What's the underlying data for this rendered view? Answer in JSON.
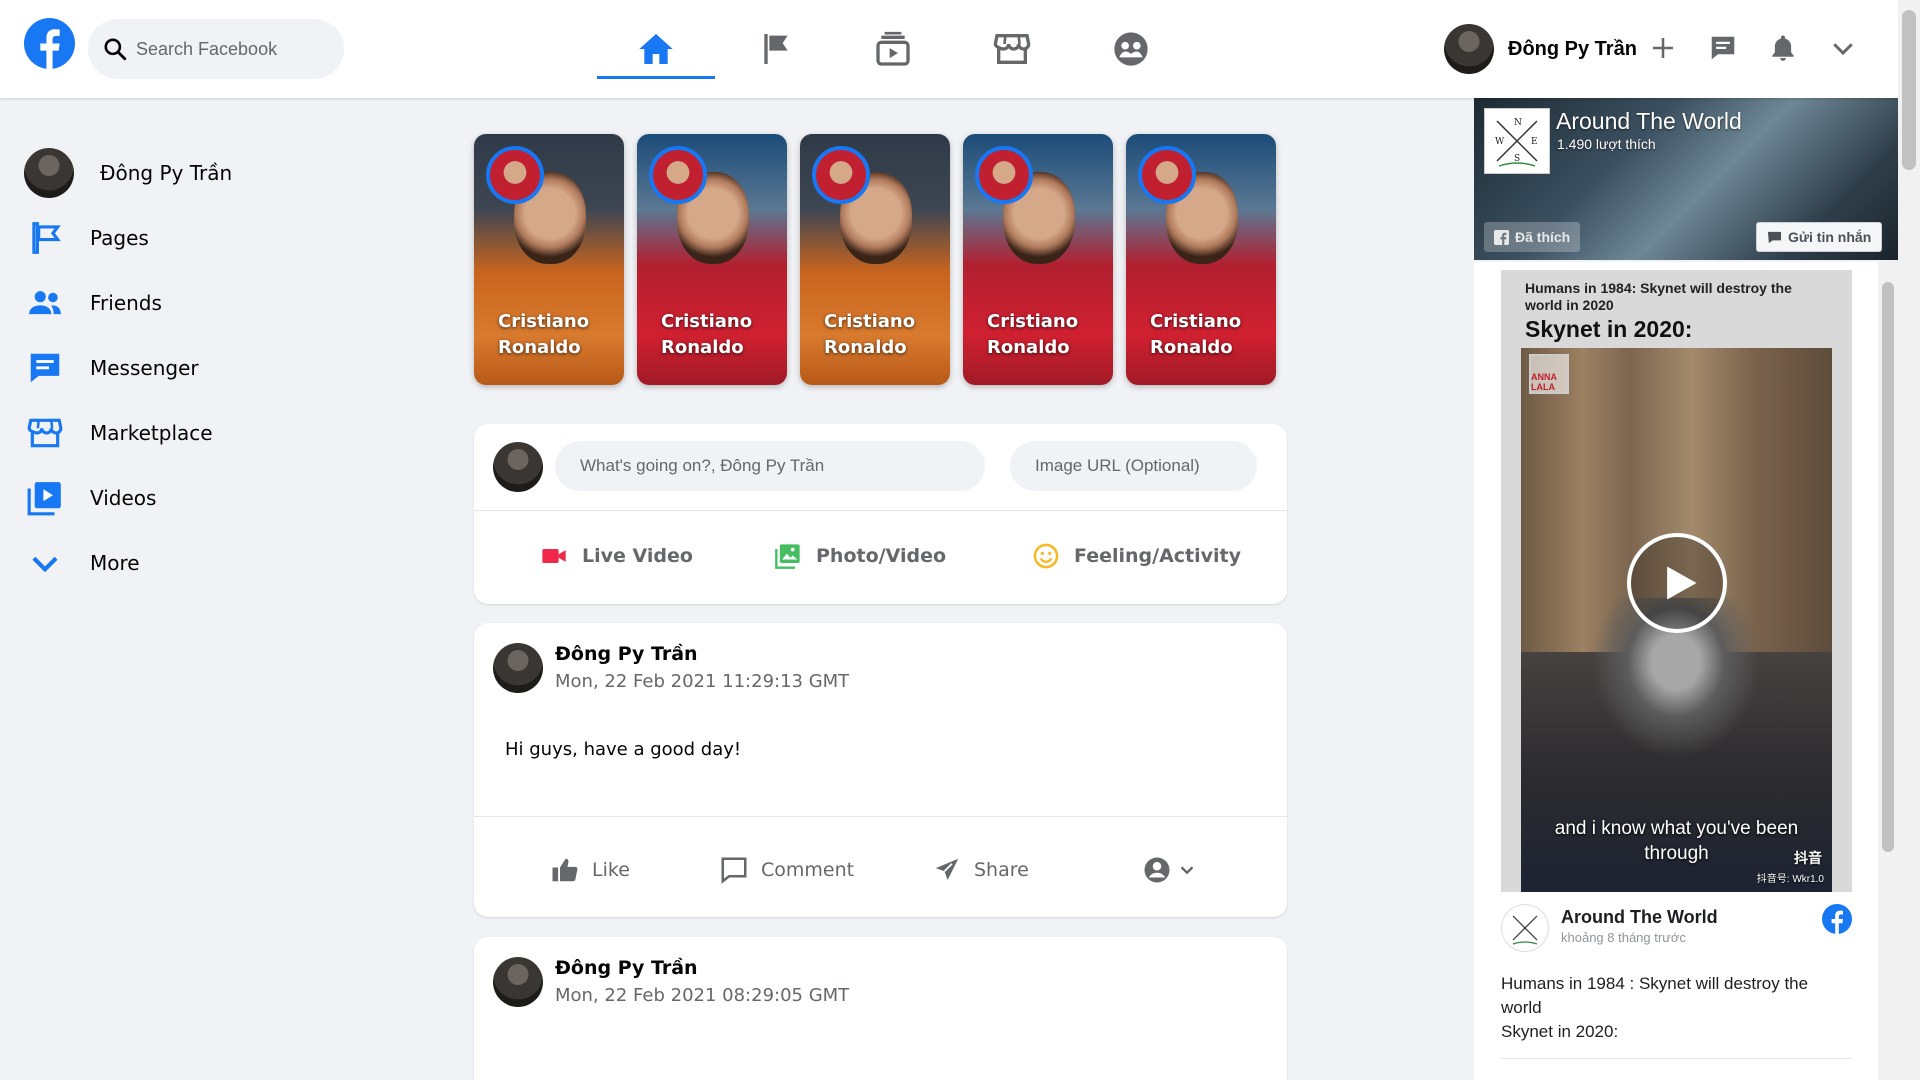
{
  "header": {
    "search_placeholder": "Search Facebook",
    "nav_tabs": [
      "home",
      "pages",
      "watch",
      "marketplace",
      "groups"
    ],
    "profile_name": "Đông Py Trần"
  },
  "sidebar": {
    "profile_name": "Đông Py Trần",
    "items": [
      {
        "label": "Pages",
        "icon": "flag-icon"
      },
      {
        "label": "Friends",
        "icon": "friends-icon"
      },
      {
        "label": "Messenger",
        "icon": "messenger-icon"
      },
      {
        "label": "Marketplace",
        "icon": "marketplace-icon"
      },
      {
        "label": "Videos",
        "icon": "videos-icon"
      },
      {
        "label": "More",
        "icon": "chevron-down-icon"
      }
    ]
  },
  "stories": [
    {
      "name": "Cristiano Ronaldo",
      "kit": "juventus"
    },
    {
      "name": "Cristiano Ronaldo",
      "kit": "portugal"
    },
    {
      "name": "Cristiano Ronaldo",
      "kit": "juventus"
    },
    {
      "name": "Cristiano Ronaldo",
      "kit": "portugal"
    },
    {
      "name": "Cristiano Ronaldo",
      "kit": "portugal"
    }
  ],
  "composer": {
    "status_placeholder": "What's going on?, Đông Py Trần",
    "image_placeholder": "Image URL (Optional)",
    "actions": {
      "live": "Live Video",
      "photo": "Photo/Video",
      "feeling": "Feeling/Activity"
    }
  },
  "posts": [
    {
      "author": "Đông Py Trần",
      "time": "Mon, 22 Feb 2021 11:29:13 GMT",
      "text": "Hi guys, have a good day!"
    },
    {
      "author": "Đông Py Trần",
      "time": "Mon, 22 Feb 2021 08:29:05 GMT",
      "text": ""
    }
  ],
  "post_actions": {
    "like": "Like",
    "comment": "Comment",
    "share": "Share"
  },
  "page_plugin": {
    "name": "Around The World",
    "likes": "1.490 lượt thích",
    "like_button": "Đã thích",
    "message_button": "Gửi tin nhắn",
    "video": {
      "caption_line": "Humans in 1984: Skynet will destroy the world in 2020",
      "caption_big": "Skynet in 2020:",
      "subtitle": "and i know what you've been through",
      "watermark_logo": "ANNA LALA",
      "tiktok_label": "抖音",
      "tiktok_id": "抖音号: Wkr1.0"
    },
    "post": {
      "page_name": "Around The World",
      "time": "khoảng 8 tháng trước",
      "text": "Humans in 1984 : Skynet will destroy the world\nSkynet in 2020:"
    }
  },
  "colors": {
    "accent": "#1877f2",
    "live": "#f02849",
    "photo": "#45bd62",
    "feeling": "#f7b928"
  }
}
